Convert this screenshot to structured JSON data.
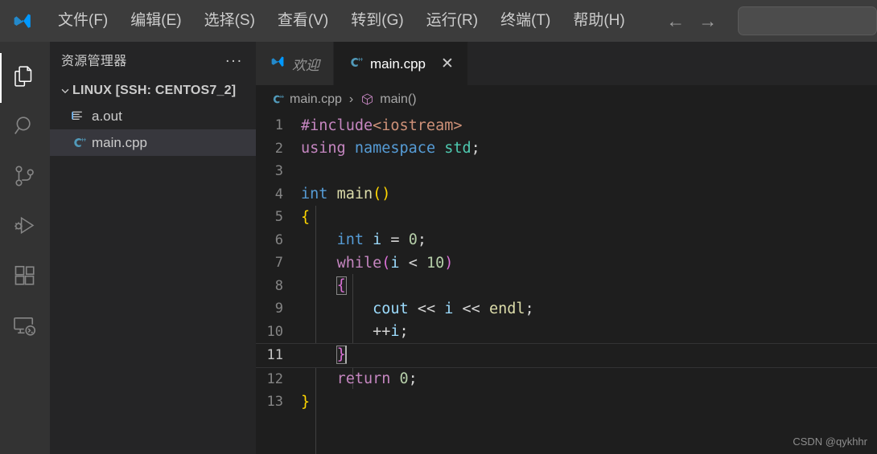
{
  "titlebar": {
    "logo_icon": "vscode-logo-icon",
    "menus": [
      {
        "label": "文件(F)",
        "name": "menu-file"
      },
      {
        "label": "编辑(E)",
        "name": "menu-edit"
      },
      {
        "label": "选择(S)",
        "name": "menu-selection"
      },
      {
        "label": "查看(V)",
        "name": "menu-view"
      },
      {
        "label": "转到(G)",
        "name": "menu-go"
      },
      {
        "label": "运行(R)",
        "name": "menu-run"
      },
      {
        "label": "终端(T)",
        "name": "menu-terminal"
      },
      {
        "label": "帮助(H)",
        "name": "menu-help"
      }
    ],
    "nav_back_icon": "←",
    "nav_forward_icon": "→",
    "command_center_value": "",
    "command_center_placeholder": ""
  },
  "activitybar": {
    "items": [
      {
        "icon": "files-explorer-icon",
        "active": true
      },
      {
        "icon": "search-icon",
        "active": false
      },
      {
        "icon": "source-control-icon",
        "active": false
      },
      {
        "icon": "run-and-debug-icon",
        "active": false
      },
      {
        "icon": "extensions-icon",
        "active": false
      },
      {
        "icon": "remote-explorer-icon",
        "active": false
      }
    ]
  },
  "sidebar": {
    "title": "资源管理器",
    "more_actions_icon": "...",
    "tree": {
      "root_label": "LINUX [SSH: CENTOS7_2]",
      "root_expanded": true,
      "items": [
        {
          "label": "a.out",
          "icon": "binary-file-icon",
          "selected": false
        },
        {
          "label": "main.cpp",
          "icon": "cpp-file-icon",
          "selected": true
        }
      ]
    }
  },
  "editor": {
    "tabs": [
      {
        "label": "欢迎",
        "icon": "vscode-logo-icon",
        "active": false,
        "preview": true,
        "closable": false
      },
      {
        "label": "main.cpp",
        "icon": "cpp-file-icon",
        "active": true,
        "preview": false,
        "closable": true,
        "close_icon": "✕"
      }
    ],
    "breadcrumb": {
      "file_icon": "cpp-file-icon",
      "file": "main.cpp",
      "separator": "›",
      "symbol_icon": "symbol-function-icon",
      "symbol": "main()"
    },
    "active_line": 11,
    "total_lines": 13,
    "line_numbers": [
      "1",
      "2",
      "3",
      "4",
      "5",
      "6",
      "7",
      "8",
      "9",
      "10",
      "11",
      "12",
      "13"
    ],
    "code_lines": [
      "#include<iostream>",
      "using namespace std;",
      "",
      "int main()",
      "{",
      "    int i = 0;",
      "    while(i < 10)",
      "    {",
      "        cout << i << endl;",
      "        ++i;",
      "    }",
      "    return 0;",
      "}"
    ]
  },
  "watermark": "CSDN @qykhhr",
  "colors": {
    "titlebar_bg": "#3c3c3c",
    "activitybar_bg": "#333333",
    "sidebar_bg": "#252526",
    "editor_bg": "#1e1e1e",
    "tab_inactive_bg": "#2d2d2d",
    "selection_bg": "#37373d",
    "accent_blue": "#0098ff",
    "text": "#cccccc"
  }
}
